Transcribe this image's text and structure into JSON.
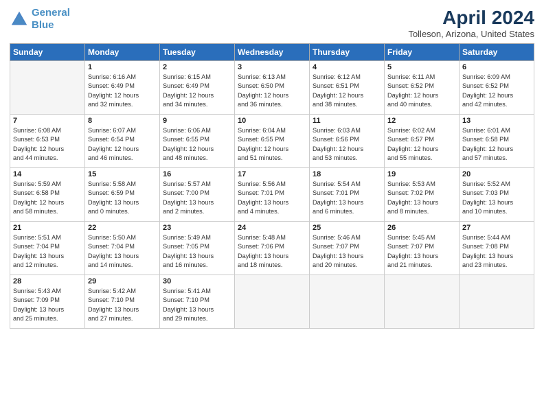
{
  "header": {
    "logo_line1": "General",
    "logo_line2": "Blue",
    "title": "April 2024",
    "subtitle": "Tolleson, Arizona, United States"
  },
  "days_of_week": [
    "Sunday",
    "Monday",
    "Tuesday",
    "Wednesday",
    "Thursday",
    "Friday",
    "Saturday"
  ],
  "weeks": [
    [
      {
        "day": "",
        "info": ""
      },
      {
        "day": "1",
        "info": "Sunrise: 6:16 AM\nSunset: 6:49 PM\nDaylight: 12 hours\nand 32 minutes."
      },
      {
        "day": "2",
        "info": "Sunrise: 6:15 AM\nSunset: 6:49 PM\nDaylight: 12 hours\nand 34 minutes."
      },
      {
        "day": "3",
        "info": "Sunrise: 6:13 AM\nSunset: 6:50 PM\nDaylight: 12 hours\nand 36 minutes."
      },
      {
        "day": "4",
        "info": "Sunrise: 6:12 AM\nSunset: 6:51 PM\nDaylight: 12 hours\nand 38 minutes."
      },
      {
        "day": "5",
        "info": "Sunrise: 6:11 AM\nSunset: 6:52 PM\nDaylight: 12 hours\nand 40 minutes."
      },
      {
        "day": "6",
        "info": "Sunrise: 6:09 AM\nSunset: 6:52 PM\nDaylight: 12 hours\nand 42 minutes."
      }
    ],
    [
      {
        "day": "7",
        "info": "Sunrise: 6:08 AM\nSunset: 6:53 PM\nDaylight: 12 hours\nand 44 minutes."
      },
      {
        "day": "8",
        "info": "Sunrise: 6:07 AM\nSunset: 6:54 PM\nDaylight: 12 hours\nand 46 minutes."
      },
      {
        "day": "9",
        "info": "Sunrise: 6:06 AM\nSunset: 6:55 PM\nDaylight: 12 hours\nand 48 minutes."
      },
      {
        "day": "10",
        "info": "Sunrise: 6:04 AM\nSunset: 6:55 PM\nDaylight: 12 hours\nand 51 minutes."
      },
      {
        "day": "11",
        "info": "Sunrise: 6:03 AM\nSunset: 6:56 PM\nDaylight: 12 hours\nand 53 minutes."
      },
      {
        "day": "12",
        "info": "Sunrise: 6:02 AM\nSunset: 6:57 PM\nDaylight: 12 hours\nand 55 minutes."
      },
      {
        "day": "13",
        "info": "Sunrise: 6:01 AM\nSunset: 6:58 PM\nDaylight: 12 hours\nand 57 minutes."
      }
    ],
    [
      {
        "day": "14",
        "info": "Sunrise: 5:59 AM\nSunset: 6:58 PM\nDaylight: 12 hours\nand 58 minutes."
      },
      {
        "day": "15",
        "info": "Sunrise: 5:58 AM\nSunset: 6:59 PM\nDaylight: 13 hours\nand 0 minutes."
      },
      {
        "day": "16",
        "info": "Sunrise: 5:57 AM\nSunset: 7:00 PM\nDaylight: 13 hours\nand 2 minutes."
      },
      {
        "day": "17",
        "info": "Sunrise: 5:56 AM\nSunset: 7:01 PM\nDaylight: 13 hours\nand 4 minutes."
      },
      {
        "day": "18",
        "info": "Sunrise: 5:54 AM\nSunset: 7:01 PM\nDaylight: 13 hours\nand 6 minutes."
      },
      {
        "day": "19",
        "info": "Sunrise: 5:53 AM\nSunset: 7:02 PM\nDaylight: 13 hours\nand 8 minutes."
      },
      {
        "day": "20",
        "info": "Sunrise: 5:52 AM\nSunset: 7:03 PM\nDaylight: 13 hours\nand 10 minutes."
      }
    ],
    [
      {
        "day": "21",
        "info": "Sunrise: 5:51 AM\nSunset: 7:04 PM\nDaylight: 13 hours\nand 12 minutes."
      },
      {
        "day": "22",
        "info": "Sunrise: 5:50 AM\nSunset: 7:04 PM\nDaylight: 13 hours\nand 14 minutes."
      },
      {
        "day": "23",
        "info": "Sunrise: 5:49 AM\nSunset: 7:05 PM\nDaylight: 13 hours\nand 16 minutes."
      },
      {
        "day": "24",
        "info": "Sunrise: 5:48 AM\nSunset: 7:06 PM\nDaylight: 13 hours\nand 18 minutes."
      },
      {
        "day": "25",
        "info": "Sunrise: 5:46 AM\nSunset: 7:07 PM\nDaylight: 13 hours\nand 20 minutes."
      },
      {
        "day": "26",
        "info": "Sunrise: 5:45 AM\nSunset: 7:07 PM\nDaylight: 13 hours\nand 21 minutes."
      },
      {
        "day": "27",
        "info": "Sunrise: 5:44 AM\nSunset: 7:08 PM\nDaylight: 13 hours\nand 23 minutes."
      }
    ],
    [
      {
        "day": "28",
        "info": "Sunrise: 5:43 AM\nSunset: 7:09 PM\nDaylight: 13 hours\nand 25 minutes."
      },
      {
        "day": "29",
        "info": "Sunrise: 5:42 AM\nSunset: 7:10 PM\nDaylight: 13 hours\nand 27 minutes."
      },
      {
        "day": "30",
        "info": "Sunrise: 5:41 AM\nSunset: 7:10 PM\nDaylight: 13 hours\nand 29 minutes."
      },
      {
        "day": "",
        "info": ""
      },
      {
        "day": "",
        "info": ""
      },
      {
        "day": "",
        "info": ""
      },
      {
        "day": "",
        "info": ""
      }
    ]
  ]
}
